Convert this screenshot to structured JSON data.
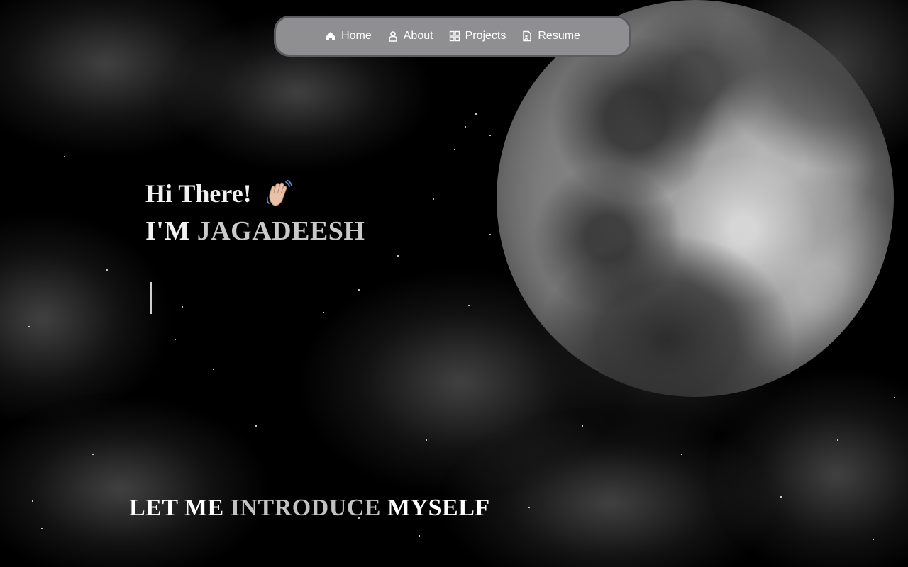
{
  "nav": {
    "items": [
      {
        "label": "Home",
        "icon": "home-icon"
      },
      {
        "label": "About",
        "icon": "user-icon"
      },
      {
        "label": "Projects",
        "icon": "grid-icon"
      },
      {
        "label": "Resume",
        "icon": "document-icon"
      }
    ]
  },
  "hero": {
    "greeting": "Hi There!",
    "greeting_icon": "waving-hand-icon",
    "name_prefix": "I'M",
    "name": "JAGADEESH"
  },
  "intro": {
    "part1": "LET ME",
    "highlight": "INTRODUCE",
    "part2": "MYSELF"
  },
  "colors": {
    "background": "#000000",
    "navbar_bg": "#8f8f92",
    "navbar_border": "#5c5c60",
    "text": "#f2f2f2",
    "highlight": "#c9c9c9"
  }
}
